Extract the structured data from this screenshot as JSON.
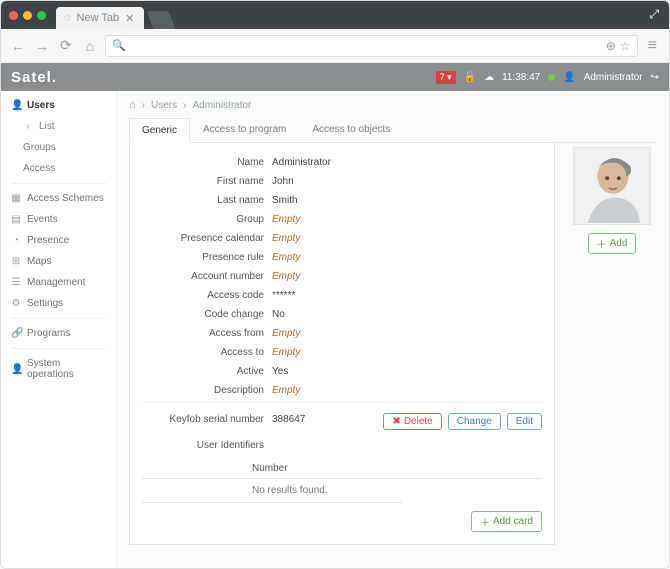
{
  "browser": {
    "tab_title": "New Tab",
    "search_placeholder": ""
  },
  "header": {
    "brand": "Satel.",
    "notif_count": "7",
    "time": "11:38:47",
    "user_label": "Administrator"
  },
  "sidebar": {
    "users": "Users",
    "list": "List",
    "groups": "Groups",
    "access": "Access",
    "access_schemes": "Access Schemes",
    "events": "Events",
    "presence": "Presence",
    "maps": "Maps",
    "management": "Management",
    "settings": "Settings",
    "programs": "Programs",
    "sysops": "System operations"
  },
  "crumbs": {
    "users": "Users",
    "admin": "Administrator"
  },
  "tabs": {
    "generic": "Generic",
    "atp": "Access to program",
    "ato": "Access to objects"
  },
  "form": {
    "name_l": "Name",
    "name_v": "Administrator",
    "first_l": "First name",
    "first_v": "John",
    "last_l": "Last name",
    "last_v": "Smith",
    "group_l": "Group",
    "group_v": "Empty",
    "pcal_l": "Presence calendar",
    "pcal_v": "Empty",
    "prule_l": "Presence rule",
    "prule_v": "Empty",
    "acct_l": "Account number",
    "acct_v": "Empty",
    "code_l": "Access code",
    "code_v": "******",
    "codech_l": "Code change",
    "codech_v": "No",
    "afrom_l": "Access from",
    "afrom_v": "Empty",
    "ato_l": "Access to",
    "ato_v": "Empty",
    "active_l": "Active",
    "active_v": "Yes",
    "desc_l": "Description",
    "desc_v": "Empty",
    "keyfob_l": "Keyfob serial number",
    "keyfob_v": "388647",
    "ident_l": "User Identifiers",
    "ident_col": "Number",
    "ident_empty": "No results found."
  },
  "buttons": {
    "delete": "Delete",
    "change": "Change",
    "edit": "Edit",
    "add": "Add",
    "add_card": "Add card"
  }
}
